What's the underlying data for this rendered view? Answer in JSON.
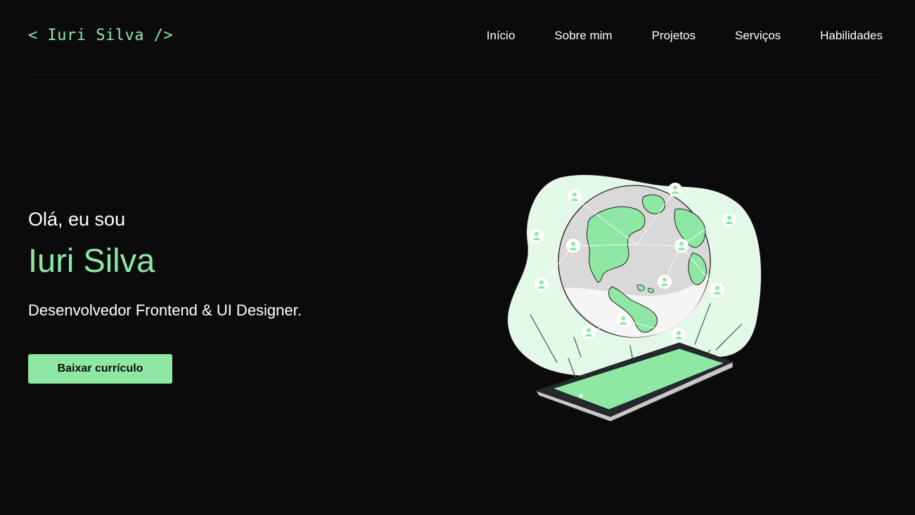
{
  "header": {
    "logo": "< Iuri Silva />",
    "nav": [
      "Início",
      "Sobre mim",
      "Projetos",
      "Serviços",
      "Habilidades"
    ]
  },
  "hero": {
    "greeting": "Olá, eu sou",
    "name": "Iuri Silva",
    "role": "Desenvolvedor Frontend & UI Designer.",
    "cta_label": "Baixar currículo"
  },
  "colors": {
    "background": "#0b0b0b",
    "accent": "#8fe7a4",
    "text": "#ffffff",
    "blob": "#e4f8e8"
  },
  "illustration": {
    "icon": "globe-tablet-network-illustration"
  }
}
